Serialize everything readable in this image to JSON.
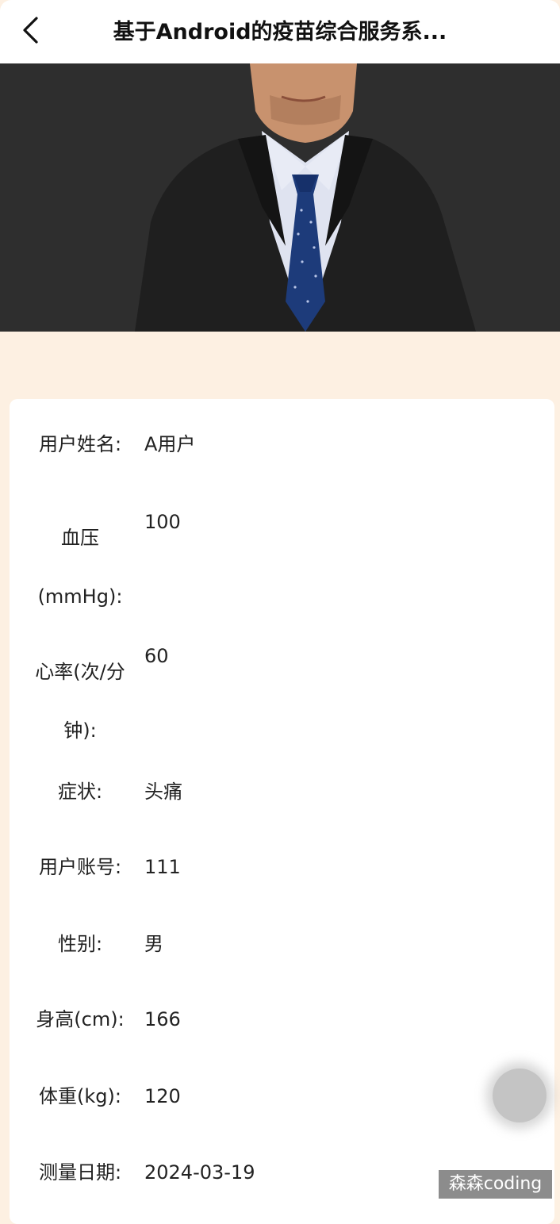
{
  "header": {
    "title": "基于Android的疫苗综合服务系..."
  },
  "icons": {
    "back": "chevron-left-icon",
    "fab": "circle-icon"
  },
  "colors": {
    "page_background": "#fdf0e2",
    "card_background": "#ffffff",
    "hero_background": "#2e2e2e",
    "text": "#222222"
  },
  "details": [
    {
      "label": "用户姓名:",
      "value": "A用户"
    },
    {
      "label": "血压(mmHg):",
      "value": "100"
    },
    {
      "label": "心率(次/分钟):",
      "value": "60"
    },
    {
      "label": "症状:",
      "value": "头痛"
    },
    {
      "label": "用户账号:",
      "value": "111"
    },
    {
      "label": "性别:",
      "value": "男"
    },
    {
      "label": "身高(cm):",
      "value": "166"
    },
    {
      "label": "体重(kg):",
      "value": "120"
    },
    {
      "label": "测量日期:",
      "value": "2024-03-19"
    }
  ],
  "watermark": "森森coding"
}
